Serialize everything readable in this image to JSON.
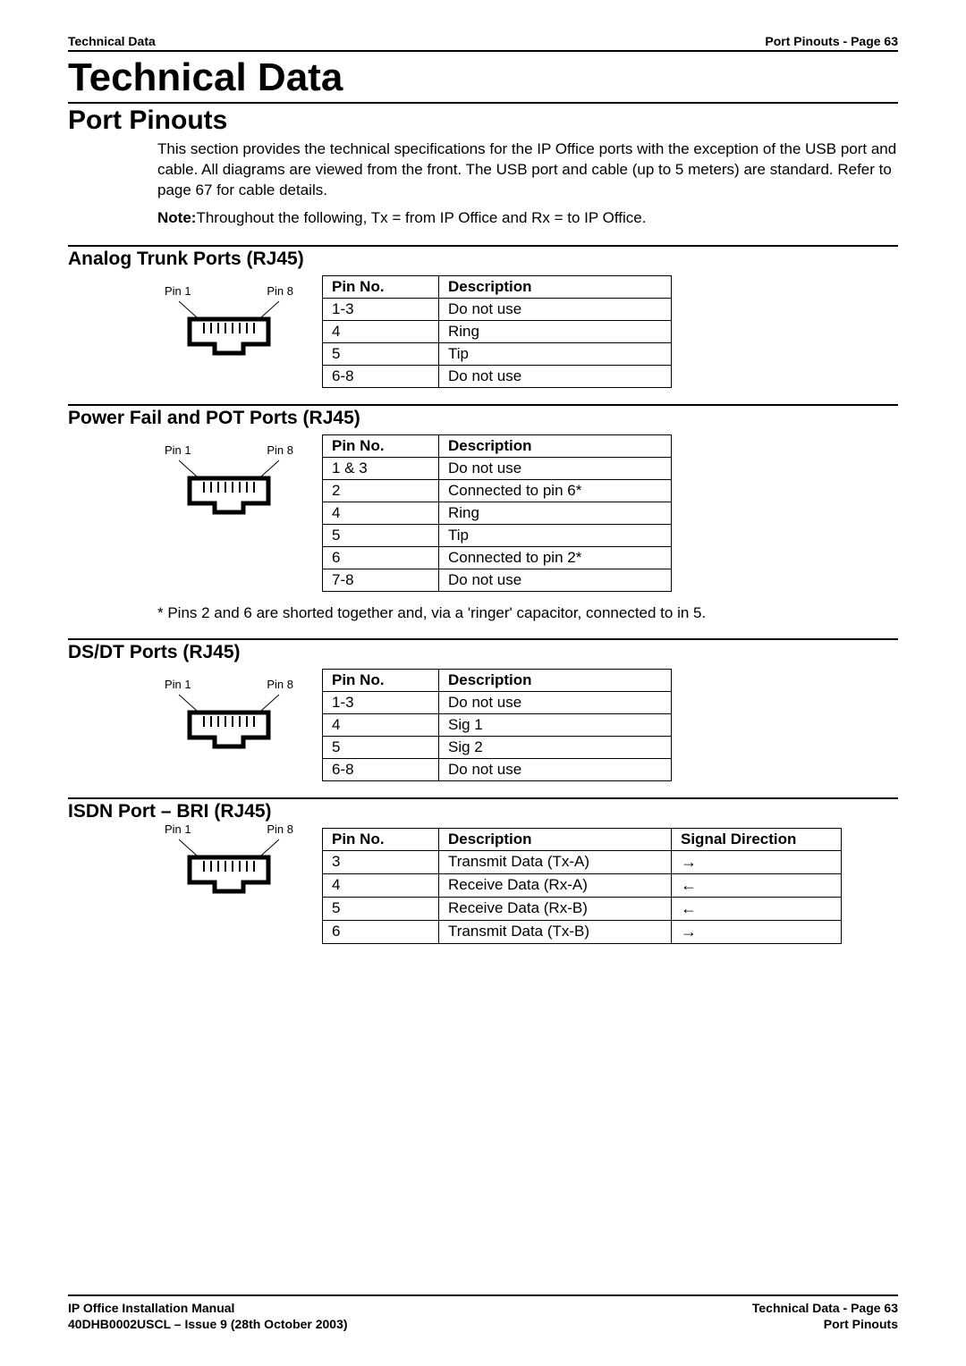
{
  "header": {
    "left": "Technical Data",
    "right": "Port Pinouts - Page 63"
  },
  "main_title": "Technical Data",
  "section_title": "Port Pinouts",
  "intro": {
    "para1": "This section provides the technical specifications for the IP Office ports with the exception of the USB port and cable.  All diagrams are viewed from the front. The USB port and cable (up to 5 meters) are standard. Refer to page 67 for cable details.",
    "note_label": "Note:",
    "note_text": "Throughout the following, Tx = from IP Office and Rx = to IP Office."
  },
  "rj45": {
    "pin1_label": "Pin 1",
    "pin8_label": "Pin 8"
  },
  "tables": {
    "header_pin": "Pin No.",
    "header_desc": "Description",
    "header_sig": "Signal Direction"
  },
  "analog": {
    "title": "Analog Trunk Ports (RJ45)",
    "rows": [
      {
        "pin": "1-3",
        "desc": "Do not use"
      },
      {
        "pin": "4",
        "desc": "Ring"
      },
      {
        "pin": "5",
        "desc": "Tip"
      },
      {
        "pin": "6-8",
        "desc": "Do not use"
      }
    ]
  },
  "powerfail": {
    "title": "Power Fail and POT Ports (RJ45)",
    "rows": [
      {
        "pin": "1 & 3",
        "desc": "Do not use"
      },
      {
        "pin": "2",
        "desc": "Connected to pin 6*"
      },
      {
        "pin": "4",
        "desc": "Ring"
      },
      {
        "pin": "5",
        "desc": "Tip"
      },
      {
        "pin": "6",
        "desc": "Connected to pin 2*"
      },
      {
        "pin": "7-8",
        "desc": "Do not use"
      }
    ],
    "footnote": "* Pins 2 and 6 are shorted together and, via a 'ringer' capacitor, connected to in 5."
  },
  "dsdt": {
    "title": "DS/DT Ports (RJ45)",
    "rows": [
      {
        "pin": "1-3",
        "desc": "Do not use"
      },
      {
        "pin": "4",
        "desc": "Sig 1"
      },
      {
        "pin": "5",
        "desc": "Sig 2"
      },
      {
        "pin": "6-8",
        "desc": "Do not use"
      }
    ]
  },
  "isdn": {
    "title": "ISDN Port – BRI (RJ45)",
    "rows": [
      {
        "pin": "3",
        "desc": "Transmit Data (Tx-A)",
        "sig": "→"
      },
      {
        "pin": "4",
        "desc": "Receive Data (Rx-A)",
        "sig": "←"
      },
      {
        "pin": "5",
        "desc": "Receive Data (Rx-B)",
        "sig": "←"
      },
      {
        "pin": "6",
        "desc": "Transmit Data (Tx-B)",
        "sig": "→"
      }
    ]
  },
  "footer": {
    "left1": "IP Office Installation Manual",
    "left2": "40DHB0002USCL – Issue 9 (28th October 2003)",
    "right1": "Technical Data - Page 63",
    "right2": "Port Pinouts"
  }
}
